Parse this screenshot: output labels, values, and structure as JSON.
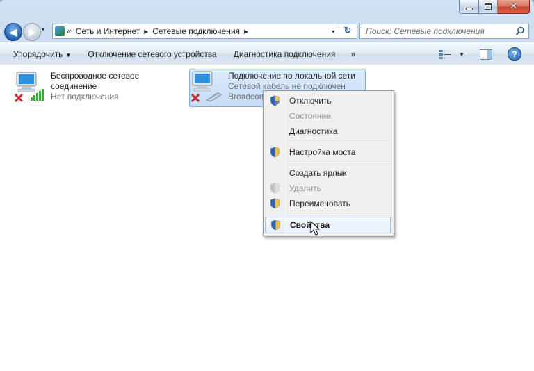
{
  "window": {
    "close_glyph": "✕"
  },
  "nav": {
    "back_glyph": "◀",
    "forward_glyph": "▶",
    "dropdown_glyph": "▾"
  },
  "address": {
    "overflow_glyph": "«",
    "crumbs": [
      "Сеть и Интернет",
      "Сетевые подключения"
    ],
    "separator_glyph": "▶",
    "dropdown_glyph": "▾",
    "refresh_glyph": "↻"
  },
  "search": {
    "placeholder": "Поиск: Сетевые подключения"
  },
  "toolbar": {
    "organize": "Упорядочить",
    "organize_arrow": "▼",
    "disable_device": "Отключение сетевого устройства",
    "diagnose": "Диагностика подключения",
    "more": "»",
    "view_arrow": "▼",
    "help": "?"
  },
  "connections": [
    {
      "name_line1": "Беспроводное сетевое",
      "name_line2": "соединение",
      "status": "Нет подключения",
      "icon": "wireless-network-icon"
    },
    {
      "name_line1": "Подключение по локальной сети",
      "status": "Сетевой кабель не подключен",
      "adapter": "Broadcom",
      "icon": "lan-network-icon",
      "selected": true
    }
  ],
  "context_menu": {
    "items": [
      {
        "label": "Отключить",
        "shield": true,
        "disabled": false
      },
      {
        "label": "Состояние",
        "shield": false,
        "disabled": true
      },
      {
        "label": "Диагностика",
        "shield": false,
        "disabled": false
      },
      {
        "label": "Настройка моста",
        "shield": true,
        "disabled": false
      },
      {
        "label": "Создать ярлык",
        "shield": false,
        "disabled": false
      },
      {
        "label": "Удалить",
        "shield": true,
        "disabled": true
      },
      {
        "label": "Переименовать",
        "shield": true,
        "disabled": false
      },
      {
        "label": "Свойства",
        "shield": true,
        "disabled": false,
        "bold": true,
        "hovered": true
      }
    ]
  },
  "colors": {
    "accent_blue": "#1d5fb3",
    "error_red": "#d2232a",
    "signal_green": "#3fa83f"
  }
}
